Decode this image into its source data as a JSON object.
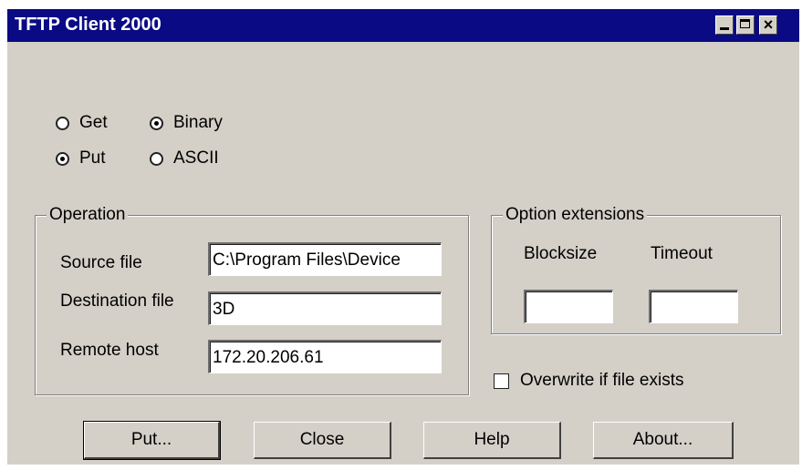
{
  "window": {
    "title": "TFTP Client 2000",
    "close_glyph": "×"
  },
  "mode": {
    "get_label": "Get",
    "put_label": "Put",
    "binary_label": "Binary",
    "ascii_label": "ASCII",
    "direction_selected": "Put",
    "transfer_selected": "Binary"
  },
  "operation": {
    "legend": "Operation",
    "source_label": "Source file",
    "source_value": "C:\\Program Files\\Device",
    "destination_label": "Destination file",
    "destination_value": "3D",
    "remote_label": "Remote host",
    "remote_value": "172.20.206.61"
  },
  "options": {
    "legend": "Option extensions",
    "blocksize_label": "Blocksize",
    "blocksize_value": "",
    "timeout_label": "Timeout",
    "timeout_value": ""
  },
  "overwrite": {
    "label": "Overwrite if file exists",
    "checked": false
  },
  "buttons": {
    "put": "Put...",
    "close": "Close",
    "help": "Help",
    "about": "About..."
  }
}
